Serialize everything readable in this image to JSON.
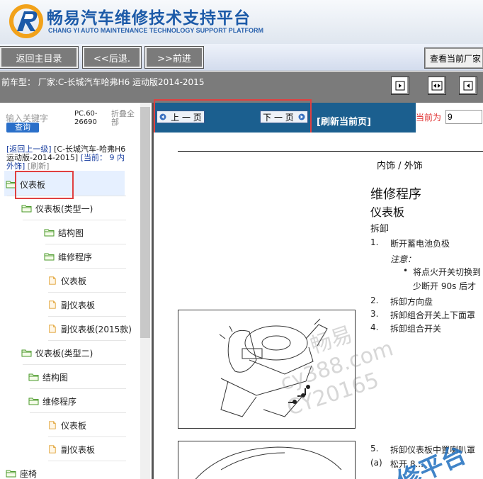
{
  "header": {
    "title_cn": "畅易汽车维修技术支持平台",
    "title_en": "CHANG YI AUTO MAINTENANCE TECHNOLOGY SUPPORT PLATFORM"
  },
  "nav": {
    "home": "返回主目录",
    "back": "<<后退.",
    "forward": ">>前进",
    "view_vendor": "查看当前厂家"
  },
  "model_bar": {
    "text": "前车型：  厂家:C-长城汽车哈弗H6 运动版2014-2015"
  },
  "sidebar": {
    "search_label": "输入关键字",
    "search_button": "查询",
    "pc_code_line1": "PC.60-",
    "pc_code_line2": "26690",
    "fold_all_line1": "折叠全",
    "fold_all_line2": "部",
    "back_up_link": "[返回上一级]",
    "back_up_path": "[C-长城汽车-哈弗H6 运动版-2014-2015]",
    "current_label": "[当前：",
    "current_value": "9 内外饰]",
    "refresh_label": "[刷新]",
    "tree": [
      {
        "label": "仪表板",
        "type": "folder"
      },
      {
        "label": "仪表板(类型一)",
        "type": "folder"
      },
      {
        "label": "结构图",
        "type": "folder"
      },
      {
        "label": "维修程序",
        "type": "folder"
      },
      {
        "label": "仪表板",
        "type": "doc"
      },
      {
        "label": "副仪表板",
        "type": "doc"
      },
      {
        "label": "副仪表板(2015款)",
        "type": "doc"
      },
      {
        "label": "仪表板(类型二)",
        "type": "folder"
      },
      {
        "label": "结构图",
        "type": "folder"
      },
      {
        "label": "维修程序",
        "type": "folder"
      },
      {
        "label": "仪表板",
        "type": "doc"
      },
      {
        "label": "副仪表板",
        "type": "doc"
      },
      {
        "label": "座椅",
        "type": "folder"
      }
    ]
  },
  "pager": {
    "prev": "上 一 页",
    "next": "下 一 页",
    "refresh": "[刷新当前页]",
    "current_label": "当前为",
    "current_value": "9"
  },
  "document": {
    "section": "内饰 / 外饰",
    "heading1": "维修程序",
    "heading2": "仪表板",
    "subheading": "拆卸",
    "steps": [
      {
        "num": "1.",
        "text": "断开蓄电池负极"
      },
      {
        "num": "",
        "text": "注意："
      },
      {
        "num": "•",
        "text": "将点火开关切换到"
      },
      {
        "num": "",
        "text": "少断开  90s  后才"
      },
      {
        "num": "2.",
        "text": "拆卸方向盘"
      },
      {
        "num": "3.",
        "text": "拆卸组合开关上下面罩"
      },
      {
        "num": "4.",
        "text": "拆卸组合开关"
      },
      {
        "num": "5.",
        "text": "拆卸仪表板中置喇叭罩"
      },
      {
        "num": "(a)",
        "text": "松开  8..."
      }
    ],
    "watermark_lines": [
      "畅易",
      "cy388.com",
      "CY20165"
    ],
    "watermark_blue": "修平台"
  },
  "colors": {
    "brand_blue": "#1c5aa8",
    "page_bar": "#1b5f8f",
    "nav_button": "#7b7b7b",
    "highlight_red": "#e04040"
  }
}
